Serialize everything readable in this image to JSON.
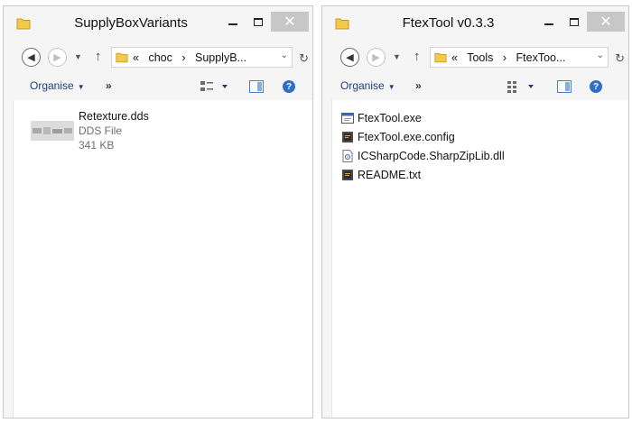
{
  "left_window": {
    "title": "SupplyBoxVariants",
    "address": {
      "overflow": "«",
      "segments": [
        "choc",
        "SupplyB..."
      ]
    },
    "toolbar": {
      "organise": "Organise",
      "more": "»"
    },
    "file": {
      "name": "Retexture.dds",
      "type": "DDS File",
      "size": "341 KB",
      "icon": "dds-thumbnail"
    }
  },
  "right_window": {
    "title": "FtexTool v0.3.3",
    "address": {
      "overflow": "«",
      "segments": [
        "Tools",
        "FtexToo..."
      ]
    },
    "toolbar": {
      "organise": "Organise",
      "more": "»"
    },
    "files": [
      {
        "name": "FtexTool.exe",
        "icon": "exe-icon"
      },
      {
        "name": "FtexTool.exe.config",
        "icon": "config-file-icon"
      },
      {
        "name": "ICSharpCode.SharpZipLib.dll",
        "icon": "dll-file-icon"
      },
      {
        "name": "README.txt",
        "icon": "txt-file-icon"
      }
    ]
  },
  "window_controls": {
    "minimize": "—",
    "maximize": "☐",
    "close": "✕"
  },
  "colors": {
    "folder": "#f3c94b",
    "close_button": "#c7c7c7",
    "link": "#1d3f7a",
    "help": "#2f6ec7"
  }
}
